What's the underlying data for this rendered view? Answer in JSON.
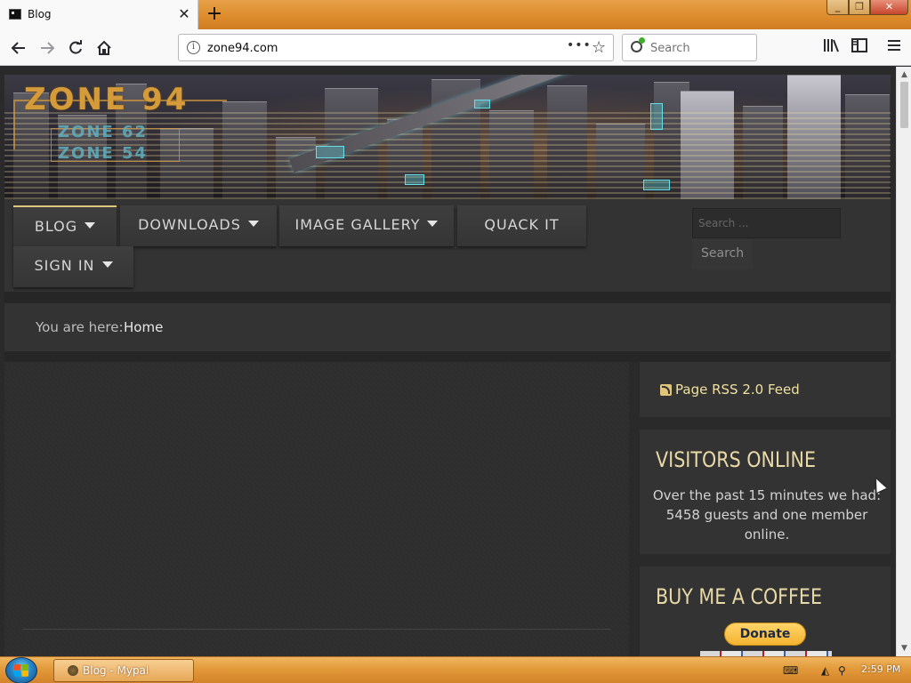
{
  "browser": {
    "tab_title": "Blog",
    "tab_close": "✕",
    "new_tab": "+",
    "url": "zone94.com",
    "page_actions": "•••",
    "bookmark_star": "☆",
    "search_placeholder": "Search"
  },
  "site": {
    "logo_text": "ZONE 94",
    "logo_sub1": "ZONE 62",
    "logo_sub2": "ZONE 54",
    "menu": [
      {
        "label": "BLOG",
        "has_caret": true
      },
      {
        "label": "DOWNLOADS",
        "has_caret": true
      },
      {
        "label": "IMAGE GALLERY",
        "has_caret": true
      },
      {
        "label": "QUACK IT",
        "has_caret": false
      },
      {
        "label": "SIGN IN",
        "has_caret": true
      }
    ],
    "site_search_placeholder": "Search ...",
    "site_search_button": "Search",
    "breadcrumb_label": "You are here:",
    "breadcrumb_home": "Home",
    "rss_link": "Page RSS 2.0 Feed",
    "visitors_title": "VISITORS ONLINE",
    "visitors_text": "Over the past 15 minutes we had: 5458 guests and one member online.",
    "coffee_title": "BUY ME A COFFEE",
    "donate_label": "Donate"
  },
  "taskbar": {
    "window_label": "Blog - Mypal",
    "clock": "2:59 PM"
  },
  "colors": {
    "accent_gold": "#e0c67a",
    "heading": "#e9d9a6",
    "taskbar": "#e39a3a"
  }
}
